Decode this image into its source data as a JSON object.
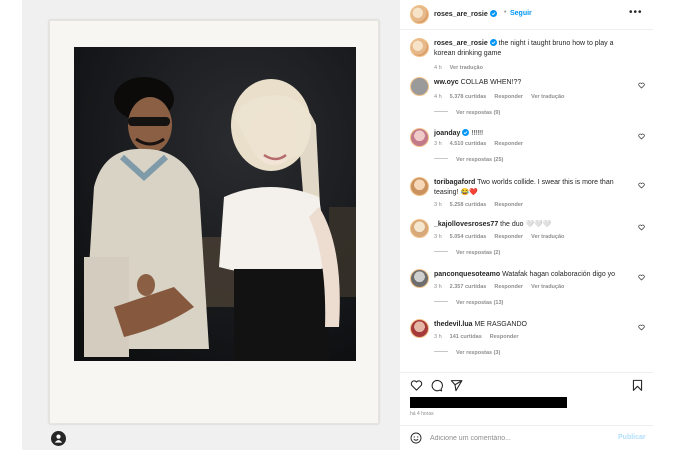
{
  "post": {
    "username": "roses_are_rosie",
    "follow_label": "Seguir",
    "separator": "•",
    "caption": "the night i taught bruno how to play a korean drinking game",
    "caption_time": "4 h",
    "caption_translate": "Ver tradução"
  },
  "comments": [
    {
      "username": "ww.oyc",
      "text": "COLLAB WHEN!??",
      "time": "4 h",
      "likes": "5.378 curtidas",
      "reply": "Responder",
      "translate": "Ver tradução",
      "replies": "Ver respostas (9)"
    },
    {
      "username": "joanday",
      "text": "!!!!!!",
      "time": "3 h",
      "likes": "4.510 curtidas",
      "reply": "Responder",
      "translate": "",
      "replies": "Ver respostas (25)"
    },
    {
      "username": "toribagaford",
      "text": "Two worlds collide. I swear this is more than teasing! 😂❤️",
      "time": "3 h",
      "likes": "5.258 curtidas",
      "reply": "Responder",
      "translate": "",
      "replies": ""
    },
    {
      "username": "_kajollovesroses77",
      "text": "the duo 🤍🤍🤍",
      "time": "3 h",
      "likes": "5.054 curtidas",
      "reply": "Responder",
      "translate": "Ver tradução",
      "replies": "Ver respostas (2)"
    },
    {
      "username": "panconquesoteamo",
      "text": "Watafak hagan colaboración digo yo",
      "time": "3 h",
      "likes": "2.357 curtidas",
      "reply": "Responder",
      "translate": "Ver tradução",
      "replies": "Ver respostas (13)"
    },
    {
      "username": "thedevil.lua",
      "text": "ME RASGANDO",
      "time": "3 h",
      "likes": "141 curtidas",
      "reply": "Responder",
      "translate": "",
      "replies": "Ver respostas (3)"
    }
  ],
  "footer": {
    "time_ago": "há 4 horas",
    "comment_placeholder": "Adicione um comentário...",
    "publish_label": "Publicar"
  },
  "icons": {
    "like": "heart-icon",
    "comment": "comment-icon",
    "share": "send-icon",
    "save": "bookmark-icon",
    "emoji": "emoji-icon",
    "more": "more-icon",
    "verified": "verified-badge-icon",
    "user_tags": "user-tag-icon"
  },
  "colors": {
    "link_blue": "#0095f6",
    "publish_disabled": "#b2dffc",
    "verified_blue": "#0095f6",
    "muted_text": "#8e8e8e"
  }
}
